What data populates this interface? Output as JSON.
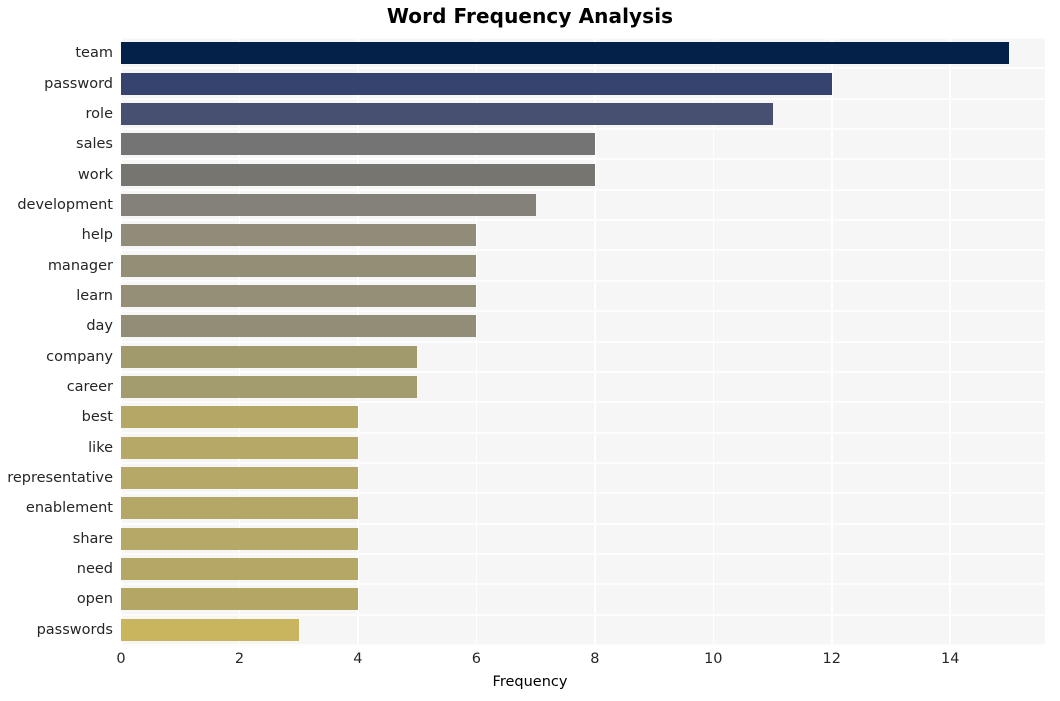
{
  "chart_data": {
    "type": "bar",
    "orientation": "horizontal",
    "title": "Word Frequency Analysis",
    "xlabel": "Frequency",
    "ylabel": "",
    "categories": [
      "team",
      "password",
      "role",
      "sales",
      "work",
      "development",
      "help",
      "manager",
      "learn",
      "day",
      "company",
      "career",
      "best",
      "like",
      "representative",
      "enablement",
      "share",
      "need",
      "open",
      "passwords"
    ],
    "values": [
      15,
      12,
      11,
      8,
      8,
      7,
      6,
      6,
      6,
      6,
      5,
      5,
      4,
      4,
      4,
      4,
      4,
      4,
      4,
      3
    ],
    "bar_colors": [
      "#042249",
      "#36436e",
      "#485072",
      "#747474",
      "#76756f",
      "#84817a",
      "#908c79",
      "#938e76",
      "#948f76",
      "#928d76",
      "#a09a6d",
      "#a39c6f",
      "#b5a866",
      "#b6a967",
      "#b6a967",
      "#b5a866",
      "#b6a967",
      "#b5a866",
      "#b4a766",
      "#c8b55e"
    ],
    "xlim": [
      0,
      15.6
    ],
    "xticks": [
      0,
      2,
      4,
      6,
      8,
      10,
      12,
      14
    ],
    "xtick_labels": [
      "0",
      "2",
      "4",
      "6",
      "8",
      "10",
      "12",
      "14"
    ],
    "grid": true,
    "grid_axis": "both",
    "grid_color": "#ffffff",
    "plot_background": "#f6f6f7",
    "figure_background": "#ffffff",
    "legend": null,
    "style": "seaborn-whitegrid"
  }
}
